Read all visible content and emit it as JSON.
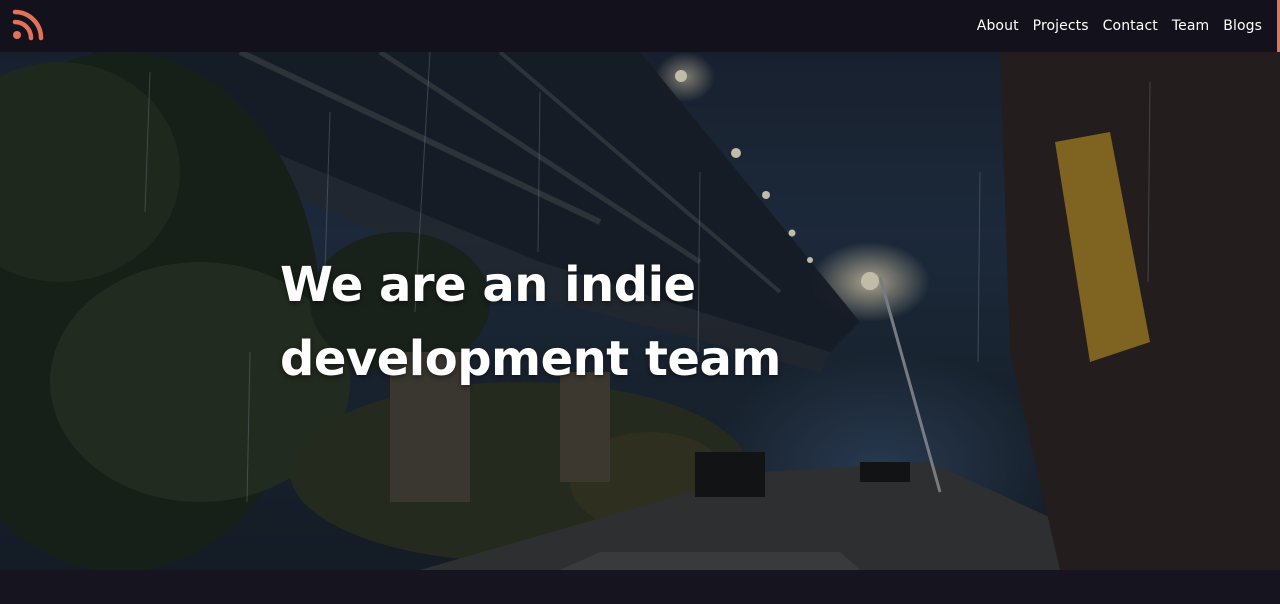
{
  "header": {
    "logo_icon": "rss-feed-icon",
    "accent_color": "#e2735a",
    "nav": [
      {
        "label": "About"
      },
      {
        "label": "Projects"
      },
      {
        "label": "Contact"
      },
      {
        "label": "Team"
      },
      {
        "label": "Blogs"
      }
    ]
  },
  "hero": {
    "headline_line1": "We are an indie",
    "headline_line2": "development team"
  }
}
